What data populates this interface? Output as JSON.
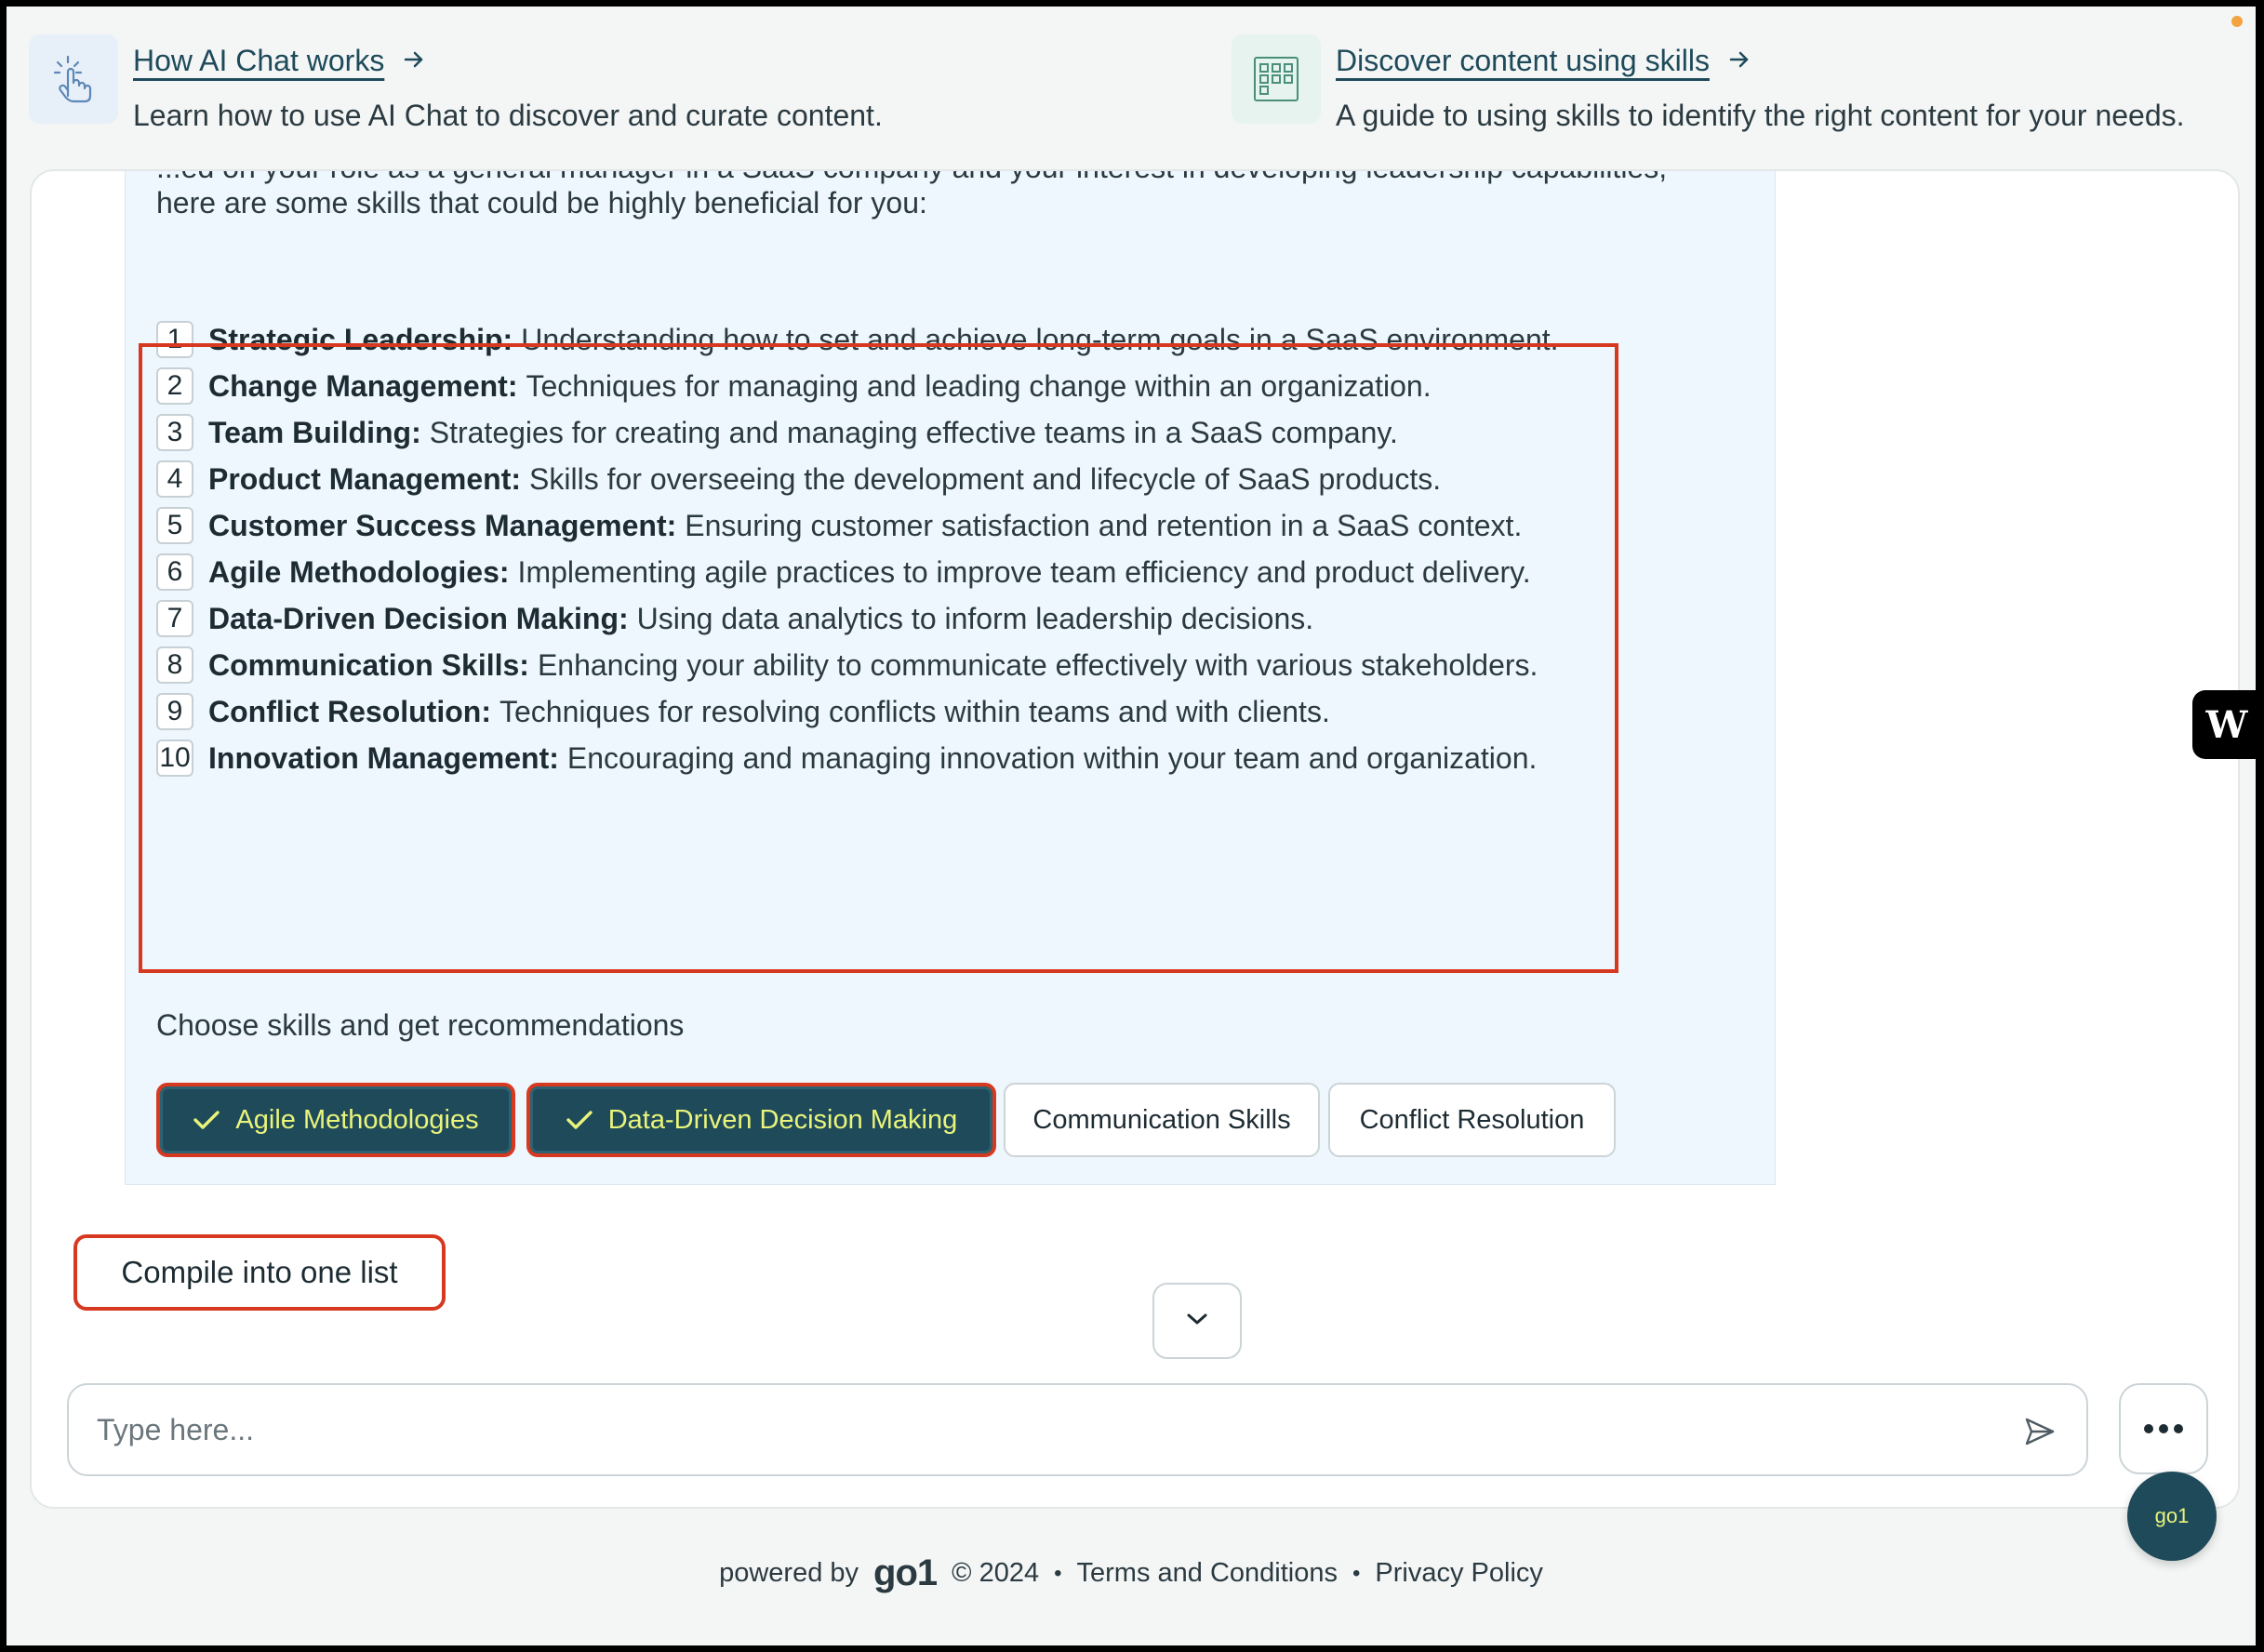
{
  "guides": [
    {
      "title": "How AI Chat works",
      "description": "Learn how to use AI Chat to discover and curate content."
    },
    {
      "title": "Discover content using skills",
      "description": "A guide to using skills to identify the right content for your needs."
    }
  ],
  "chat": {
    "intro_cut": "...ed on your role as a general manager in a SaaS company and your interest in developing leadership capabilities,",
    "intro_line2": "here are some skills that could be highly beneficial for you:",
    "skills": [
      {
        "num": "1",
        "name": "Strategic Leadership:",
        "desc": "Understanding how to set and achieve long-term goals in a SaaS environment."
      },
      {
        "num": "2",
        "name": "Change Management:",
        "desc": "Techniques for managing and leading change within an organization."
      },
      {
        "num": "3",
        "name": "Team Building:",
        "desc": "Strategies for creating and managing effective teams in a SaaS company."
      },
      {
        "num": "4",
        "name": "Product Management:",
        "desc": "Skills for overseeing the development and lifecycle of SaaS products."
      },
      {
        "num": "5",
        "name": "Customer Success Management:",
        "desc": "Ensuring customer satisfaction and retention in a SaaS context."
      },
      {
        "num": "6",
        "name": "Agile Methodologies:",
        "desc": "Implementing agile practices to improve team efficiency and product delivery."
      },
      {
        "num": "7",
        "name": "Data-Driven Decision Making:",
        "desc": "Using data analytics to inform leadership decisions."
      },
      {
        "num": "8",
        "name": "Communication Skills:",
        "desc": "Enhancing your ability to communicate effectively with various stakeholders."
      },
      {
        "num": "9",
        "name": "Conflict Resolution:",
        "desc": "Techniques for resolving conflicts within teams and with clients."
      },
      {
        "num": "10",
        "name": "Innovation Management:",
        "desc": "Encouraging and managing innovation within your team and organization."
      }
    ],
    "choose_label": "Choose skills and get recommendations",
    "chips": [
      {
        "label": "Agile Methodologies",
        "selected": true
      },
      {
        "label": "Data-Driven Decision Making",
        "selected": true
      },
      {
        "label": "Communication Skills",
        "selected": false
      },
      {
        "label": "Conflict Resolution",
        "selected": false
      }
    ]
  },
  "actions": {
    "compile_label": "Compile into one list"
  },
  "input": {
    "placeholder": "Type here..."
  },
  "float_badge": "go1",
  "widget_badge": "W",
  "footer": {
    "powered_by": "powered by",
    "brand": "go1",
    "copyright": "© 2024",
    "terms": "Terms and Conditions",
    "privacy": "Privacy Policy",
    "separator": "•"
  },
  "colors": {
    "accent_dark": "#1e4a5a",
    "accent_lime": "#e9f47a",
    "highlight_red": "#d6391f",
    "bubble_bg": "#eef6fe"
  }
}
